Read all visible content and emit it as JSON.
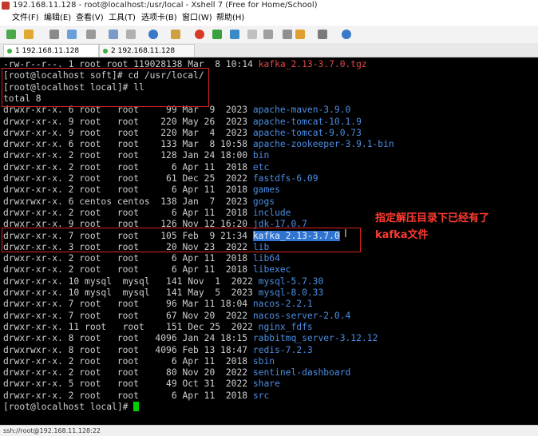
{
  "window": {
    "title": "192.168.11.128 - root@localhost:/usr/local - Xshell 7 (Free for Home/School)"
  },
  "menu": [
    "文件(F)",
    "编辑(E)",
    "查看(V)",
    "工具(T)",
    "选项卡(B)",
    "窗口(W)",
    "帮助(H)"
  ],
  "tabs": [
    {
      "label": "1 192.168.11.128",
      "active": true
    },
    {
      "label": "2 192.168.11.128",
      "active": false
    }
  ],
  "terminal": {
    "lines": [
      {
        "text": "-rw-r--r--. 1 root root 119028138 Mar  8 10:14 ",
        "name": "kafka_2.13-3.7.0.tgz",
        "name_color": "red"
      },
      {
        "text": "[root@localhost soft]# cd /usr/local/"
      },
      {
        "text": "[root@localhost local]# ll"
      },
      {
        "text": "total 8"
      },
      {
        "text": "drwxr-xr-x. 6 root   root     99 Mar  9  2023 ",
        "name": "apache-maven-3.9.0"
      },
      {
        "text": "drwxr-xr-x. 9 root   root    220 May 26  2023 ",
        "name": "apache-tomcat-10.1.9"
      },
      {
        "text": "drwxr-xr-x. 9 root   root    220 Mar  4  2023 ",
        "name": "apache-tomcat-9.0.73"
      },
      {
        "text": "drwxr-xr-x. 6 root   root    133 Mar  8 10:58 ",
        "name": "apache-zookeeper-3.9.1-bin"
      },
      {
        "text": "drwxr-xr-x. 2 root   root    128 Jan 24 18:00 ",
        "name": "bin"
      },
      {
        "text": "drwxr-xr-x. 2 root   root      6 Apr 11  2018 ",
        "name": "etc"
      },
      {
        "text": "drwxr-xr-x. 2 root   root     61 Dec 25  2022 ",
        "name": "fastdfs-6.09"
      },
      {
        "text": "drwxr-xr-x. 2 root   root      6 Apr 11  2018 ",
        "name": "games"
      },
      {
        "text": "drwxrwxr-x. 6 centos centos  138 Jan  7  2023 ",
        "name": "gogs"
      },
      {
        "text": "drwxr-xr-x. 2 root   root      6 Apr 11  2018 ",
        "name": "include"
      },
      {
        "text": "drwxr-xr-x. 9 root   root    126 Nov 12 16:20 ",
        "name": "jdk-17.0.7"
      },
      {
        "text": "drwxr-xr-x. 7 root   root    105 Feb  9 21:34 ",
        "name": "kafka_2.13-3.7.0",
        "name_color": "highlight"
      },
      {
        "text": "drwxr-xr-x. 3 root   root     20 Nov 23  2022 ",
        "name": "lib"
      },
      {
        "text": "drwxr-xr-x. 2 root   root      6 Apr 11  2018 ",
        "name": "lib64"
      },
      {
        "text": "drwxr-xr-x. 2 root   root      6 Apr 11  2018 ",
        "name": "libexec"
      },
      {
        "text": "drwxr-xr-x. 10 mysql  mysql   141 Nov  1  2022 ",
        "name": "mysql-5.7.30"
      },
      {
        "text": "drwxr-xr-x. 10 mysql  mysql   141 May  5  2023 ",
        "name": "mysql-8.0.33"
      },
      {
        "text": "drwxr-xr-x. 7 root   root     96 Mar 11 18:04 ",
        "name": "nacos-2.2.1"
      },
      {
        "text": "drwxr-xr-x. 7 root   root     67 Nov 20  2022 ",
        "name": "nacos-server-2.0.4"
      },
      {
        "text": "drwxr-xr-x. 11 root   root    151 Dec 25  2022 ",
        "name": "nginx_fdfs"
      },
      {
        "text": "drwxr-xr-x. 8 root   root   4096 Jan 24 18:15 ",
        "name": "rabbitmq_server-3.12.12"
      },
      {
        "text": "drwxrwxr-x. 8 root   root   4096 Feb 13 18:47 ",
        "name": "redis-7.2.3"
      },
      {
        "text": "drwxr-xr-x. 2 root   root      6 Apr 11  2018 ",
        "name": "sbin"
      },
      {
        "text": "drwxr-xr-x. 2 root   root     80 Nov 20  2022 ",
        "name": "sentinel-dashboard"
      },
      {
        "text": "drwxr-xr-x. 5 root   root     49 Oct 31  2022 ",
        "name": "share"
      },
      {
        "text": "drwxr-xr-x. 2 root   root      6 Apr 11  2018 ",
        "name": "src"
      },
      {
        "text": "[root@localhost local]# ",
        "cursor": true
      }
    ]
  },
  "annotation": {
    "line1": "指定解压目录下已经有了",
    "line2": "kafka文件",
    "color": "#ff3b30"
  },
  "colors": {
    "dir": "#4b8de3",
    "archive": "#e04848",
    "highlight": "#2f74d0",
    "cursor": "#00d000"
  },
  "status": {
    "text": "ssh://root@192.168.11.128:22"
  }
}
